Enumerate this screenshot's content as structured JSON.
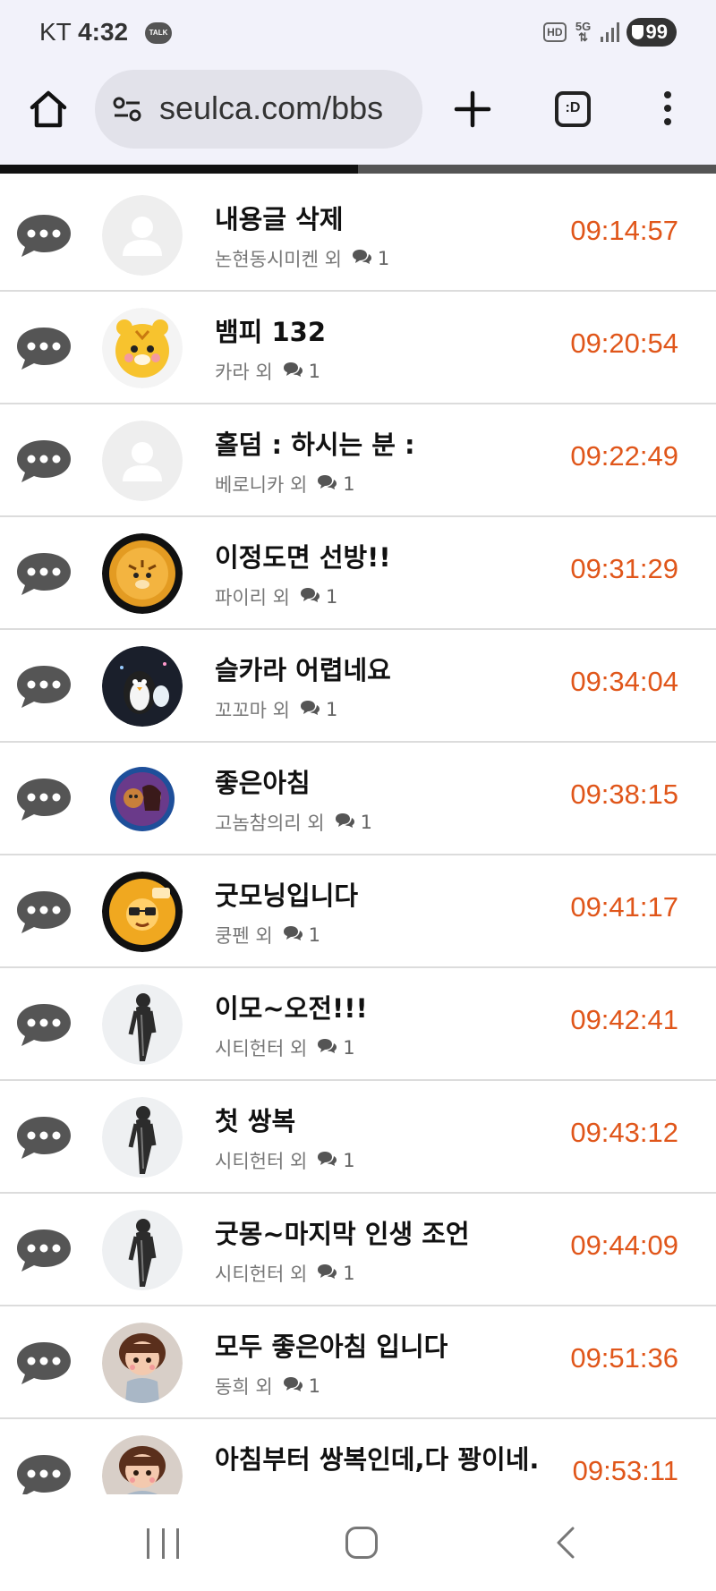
{
  "status_bar": {
    "carrier": "KT",
    "time": "4:32",
    "talk_badge": "TALK",
    "hd_badge": "HD",
    "network": "5G",
    "battery": "99"
  },
  "browser": {
    "url": "seulca.com/bbs",
    "tabs_label": ":D",
    "load_progress": 0.5
  },
  "colors": {
    "time_accent": "#e0561a",
    "title": "#111111",
    "meta": "#777777"
  },
  "posts": [
    {
      "title": "내용글 삭제",
      "author": "논현동시미켄 외",
      "comments": "1",
      "time": "09:14:57",
      "avatar": "default"
    },
    {
      "title": "뱀피 132",
      "author": "카라 외",
      "comments": "1",
      "time": "09:20:54",
      "avatar": "cartoon-tiger"
    },
    {
      "title": "홀덤 : 하시는 분 :",
      "author": "베로니카 외",
      "comments": "1",
      "time": "09:22:49",
      "avatar": "default"
    },
    {
      "title": "이정도면 선방!!",
      "author": "파이리 외",
      "comments": "1",
      "time": "09:31:29",
      "avatar": "tiger-coin"
    },
    {
      "title": "슬카라 어렵네요",
      "author": "꼬꼬마 외",
      "comments": "1",
      "time": "09:34:04",
      "avatar": "penguin"
    },
    {
      "title": "좋은아침",
      "author": "고놈참의리 외",
      "comments": "1",
      "time": "09:38:15",
      "avatar": "duo-badge"
    },
    {
      "title": "굿모닝입니다",
      "author": "쿵펜 외",
      "comments": "1",
      "time": "09:41:17",
      "avatar": "glasses-coin"
    },
    {
      "title": "이모~오전!!!",
      "author": "시티헌터 외",
      "comments": "1",
      "time": "09:42:41",
      "avatar": "walking-man"
    },
    {
      "title": "첫 쌍복",
      "author": "시티헌터 외",
      "comments": "1",
      "time": "09:43:12",
      "avatar": "walking-man"
    },
    {
      "title": "굿몽~마지막 인생 조언",
      "author": "시티헌터 외",
      "comments": "1",
      "time": "09:44:09",
      "avatar": "walking-man"
    },
    {
      "title": "모두 좋은아침 입니다",
      "author": "동희 외",
      "comments": "1",
      "time": "09:51:36",
      "avatar": "doll-girl"
    },
    {
      "title": "아침부터 쌍복인데,다 꽝이네.",
      "author": "",
      "comments": "",
      "time": "09:53:11",
      "avatar": "doll-girl"
    }
  ],
  "icons": {
    "home": "home-icon",
    "site_settings": "tune-icon",
    "new_tab": "plus-icon",
    "tabs": "tab-switcher-icon",
    "menu": "more-vert-icon",
    "post_type": "chat-bubble-icon",
    "comment": "comment-icon",
    "nav_recent": "recent-apps-icon",
    "nav_home": "nav-home-icon",
    "nav_back": "nav-back-icon"
  }
}
